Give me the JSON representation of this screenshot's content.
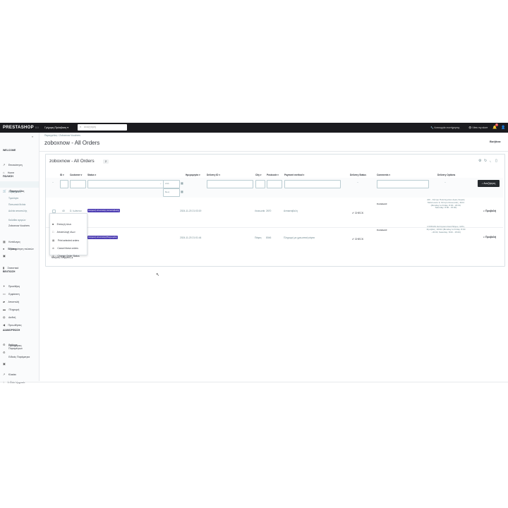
{
  "topbar": {
    "logo": "PRESTASHOP",
    "version": "8.0",
    "quick_access": "Γρήγορη Πρόσβαση ▾",
    "search_placeholder": "Αναζήτηση",
    "maintenance": "Λειτουργία συντήρησης",
    "view_store": "View my store",
    "notifications_count": "2"
  },
  "sidebar": {
    "welcome": "WELCOME",
    "items_top": [
      {
        "label": "Επισκόπηση",
        "icon": "trending-icon"
      },
      {
        "label": "Home",
        "icon": "home-icon"
      }
    ],
    "sell_header": "ΠΩΛΗΣΗ",
    "orders": "Παραγγελίες",
    "orders_sub": [
      "Παραγγελίες",
      "Τιμολόγια",
      "Πιστωτικά δελτία",
      "Δελτία αποστολής",
      "Καλάθια αγορών",
      "Zoboxnow Vouchers"
    ],
    "sell_items": [
      {
        "label": "Κατάλογος",
        "icon": "store-icon"
      },
      {
        "label": "Πελάτες",
        "icon": "account-icon"
      },
      {
        "label": "Εξυπηρέτηση πελατών",
        "icon": "chat-icon"
      },
      {
        "label": "Στατιστικά",
        "icon": "stats-icon"
      }
    ],
    "improve_header": "ΒΕΛΤΙΩΣΗ",
    "improve_items": [
      {
        "label": "Προσθήκη",
        "icon": "puzzle-icon"
      },
      {
        "label": "Εμφάνιση",
        "icon": "desktop-icon"
      },
      {
        "label": "Αποστολή",
        "icon": "truck-icon"
      },
      {
        "label": "Πληρωμή",
        "icon": "card-icon"
      },
      {
        "label": "Διεθνή",
        "icon": "globe-icon"
      },
      {
        "label": "Προωθήσεις",
        "icon": "megaphone-icon"
      }
    ],
    "config_header": "ΔΙΑΜΟΡΦΩΣΗ",
    "config_items": [
      {
        "label": "Settings",
        "icon": "gear-icon"
      },
      {
        "label": "Προτιμήσεις Παραμέτρων",
        "icon": "settings-icon"
      },
      {
        "label": "Ειδικές Παράμετροι",
        "icon": "settings-applications-icon"
      },
      {
        "label": "Κλικάκι",
        "icon": "chart-icon"
      },
      {
        "label": "1-Click Upgrade",
        "icon": "upgrade-icon"
      }
    ]
  },
  "header": {
    "breadcrumb": "Παραγγελίες  /  Zoboxnow Vouchers",
    "title": "zoboxnow - All Orders",
    "help": "Βοήθεια"
  },
  "card": {
    "title": "zoboxnow - All Orders",
    "count": "2",
    "columns": [
      "ID ▾",
      "Customer ▾",
      "Status ▾",
      "Ημερομηνία ▾",
      "Delivery ID ▾",
      "City ▾",
      "Postcode ▾",
      "Payment method ▾",
      "Delivery Status",
      "Comments ▾",
      "Delivery Options"
    ],
    "filter_from": "από",
    "filter_to": "Έως",
    "filter_dash": "--",
    "search_button": "Αναζήτηση",
    "rows": [
      {
        "id": "40",
        "customer": "D. Ιωάννου",
        "status": "Αναμονή αποστολής Αντικαταβολής",
        "date": "2024-11-20 21:03:19",
        "city": "Λευκωσία",
        "postcode": "2670",
        "payment": "Αντικαταβολή",
        "check": "CHECK",
        "comment": "Comment:",
        "address": "ΑΚΙ - Κέντρο Πολυτεχνείου Αγιας Σοφίας Μελιτωνιου 9, Κέντρο Λευκωσίας, 4101 (Monday to Friday: 8:00 - 20:00, Saturday: 8:00 - 15:00)",
        "view": "Προβολή"
      },
      {
        "id": "39",
        "customer": "Κ. Πετρίδης",
        "status": "Αναμονή αποστολής/Πληρωμένη",
        "date": "2024-11-20 21:01:44",
        "city": "Πάφος",
        "postcode": "8046",
        "payment": "Πληρωμή με χρεωστική κάρτα",
        "check": "CHECK",
        "comment": "Comment:",
        "address": "CYPRUS Αντιπροσώπεια Πάφου, 1071, Ζηνοβίας, 10134 (Monday to Friday: 8:00 - 20:00, Saturday: 8:00 - 15:00)",
        "view": "Προβολή"
      }
    ],
    "dropdown": [
      {
        "label": "Επιλογή όλων",
        "icon": "check-all-icon"
      },
      {
        "label": "Αποεπιλογή όλων",
        "icon": "uncheck-icon"
      },
      {
        "label": "Print selected orders",
        "icon": "print-icon"
      },
      {
        "label": "Cancel these orders",
        "icon": "cancel-icon"
      },
      {
        "label": "Change Order Status",
        "icon": "status-icon"
      }
    ],
    "bulk_actions": "Μαζικές ενέργειες ▴"
  }
}
